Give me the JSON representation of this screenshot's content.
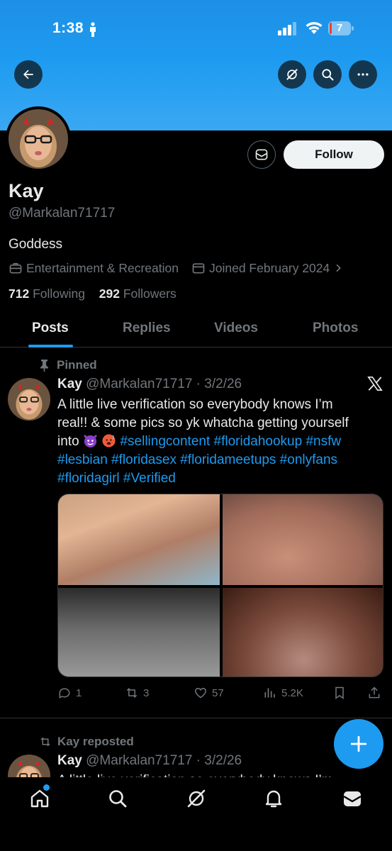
{
  "status_bar": {
    "time": "1:38",
    "battery": "7"
  },
  "header": {
    "back_icon": "arrow-left-icon",
    "grok_icon": "grok-icon",
    "search_icon": "search-icon",
    "more_icon": "more-horizontal-icon"
  },
  "profile": {
    "name": "Kay",
    "handle": "@Markalan71717",
    "bio": "Goddess",
    "category": "Entertainment & Recreation",
    "joined": "Joined February 2024",
    "following_count": "712",
    "following_label": "Following",
    "followers_count": "292",
    "followers_label": "Followers",
    "follow_button": "Follow"
  },
  "tabs": [
    {
      "label": "Posts",
      "active": true
    },
    {
      "label": "Replies",
      "active": false
    },
    {
      "label": "Videos",
      "active": false
    },
    {
      "label": "Photos",
      "active": false
    }
  ],
  "pinned_post": {
    "pinned_label": "Pinned",
    "author": "Kay",
    "handle_date": "@Markalan71717 · 3/2/26",
    "text_line1": "A little live verification so everybody knows I’m",
    "text_line2": "real!! & some pics so yk whatcha getting yourself",
    "text_into": "into",
    "hashtags_line3": "#sellingcontent #floridahookup #nsfw",
    "hashtags_line4": "#lesbian #floridasex #floridameetups #onlyfans",
    "hashtags_line5": "#floridagirl #Verified",
    "replies": "1",
    "reposts": "3",
    "likes": "57",
    "views": "5.2K"
  },
  "second_post": {
    "repost_label": "Kay reposted",
    "author": "Kay",
    "handle_date": "@Markalan71717 · 3/2/26",
    "text": "A little live verification so everybody knows I’m"
  },
  "colors": {
    "accent": "#1d9bf0",
    "background": "#000000",
    "muted": "#71767b",
    "text": "#e7e9ea"
  }
}
